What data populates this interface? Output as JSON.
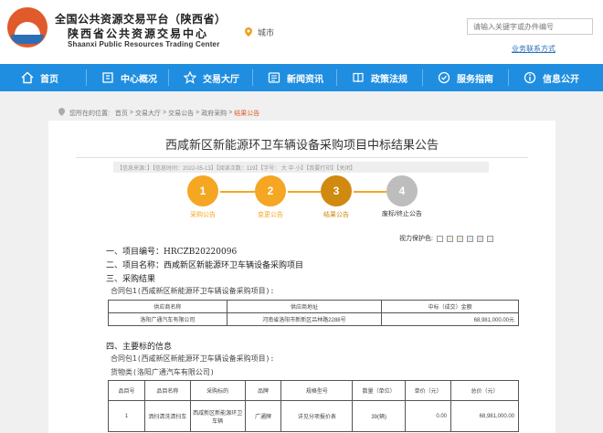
{
  "header": {
    "title_cn_line1": "全国公共资源交易平台（陕西省）",
    "title_cn_line2": "陕西省公共资源交易中心",
    "title_en": "Shaanxi Public Resources Trading Center",
    "city_label": "城市",
    "search_placeholder": "请输入关键字或办件编号",
    "biz_link": "业务联系方式"
  },
  "nav": {
    "items": [
      {
        "label": "首页",
        "icon": "home-icon"
      },
      {
        "label": "中心概况",
        "icon": "building-icon"
      },
      {
        "label": "交易大厅",
        "icon": "star-icon"
      },
      {
        "label": "新闻资讯",
        "icon": "newspaper-icon"
      },
      {
        "label": "政策法规",
        "icon": "book-icon"
      },
      {
        "label": "服务指南",
        "icon": "service-icon"
      },
      {
        "label": "信息公开",
        "icon": "info-icon"
      }
    ]
  },
  "breadcrumb": {
    "prefix": "您所在的位置:",
    "items": [
      "首页",
      "交易大厅",
      "交易公告",
      "政府采购"
    ],
    "current": "结果公告",
    "sep": " >"
  },
  "article": {
    "title": "西咸新区新能源环卫车辆设备采购项目中标结果公告",
    "meta": "【信息来源：】【信息时间：2022-05-13】【阅读次数：119】【字号： 大 中 小】【我要打印】【关闭】"
  },
  "steps": [
    {
      "num": "1",
      "label": "采购公告",
      "state": "done"
    },
    {
      "num": "2",
      "label": "变更公告",
      "state": "done"
    },
    {
      "num": "3",
      "label": "结果公告",
      "state": "current"
    },
    {
      "num": "4",
      "label": "废标/终止公告",
      "state": "pending"
    }
  ],
  "vision": {
    "label": "视力保护色:",
    "colors": [
      "#ffffff",
      "#f5f0e0",
      "#e8f0e0",
      "#e0eef5",
      "#eee0ee",
      "#f0f0f0"
    ]
  },
  "sections": {
    "s1": "一、项目编号：HRCZB20220096",
    "s2": "二、项目名称：西咸新区新能源环卫车辆设备采购项目",
    "s3": "三、采购结果",
    "s3_sub": "合同包1(西咸新区新能源环卫车辆设备采购项目):",
    "s4": "四、主要标的信息",
    "s4_sub": "合同包1(西咸新区新能源环卫车辆设备采购项目):",
    "s4_sub2": "货物类(洛阳广通汽车有限公司)"
  },
  "result_table": {
    "headers": [
      "供应商名称",
      "供应商地址",
      "中标（成交）金额"
    ],
    "rows": [
      [
        "洛阳广通汽车有限公司",
        "河南省洛阳市新新区吕林路2288号",
        "68,981,000.00元"
      ]
    ]
  },
  "item_table": {
    "headers": [
      "品目号",
      "品目名称",
      "采购标的",
      "品牌",
      "规格型号",
      "数量（单位）",
      "单价（元）",
      "总价（元）"
    ],
    "rows": [
      [
        "1",
        "洒扫清洗清扫车",
        "西咸新区新能源环卫车辆",
        "广通牌",
        "详见分项报价表",
        "39(辆)",
        "0.00",
        "68,981,000.00"
      ]
    ]
  },
  "colors": {
    "nav_blue": "#1f8ee0",
    "step_done": "#f5a623",
    "step_current": "#d08a10",
    "step_pending": "#bdbdbd",
    "accent": "#e05a2b"
  }
}
